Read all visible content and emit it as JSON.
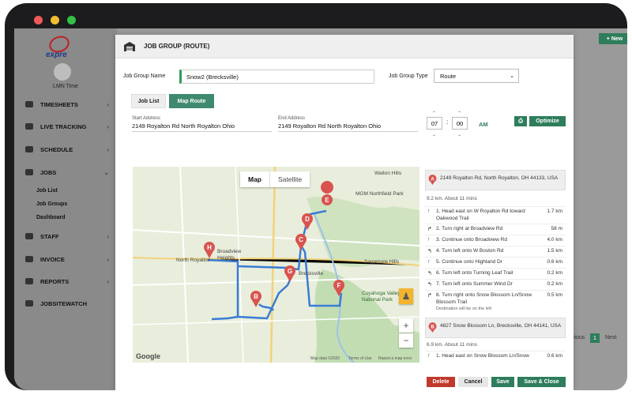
{
  "window": {
    "controls": [
      "close",
      "minimize",
      "maximize"
    ]
  },
  "app": {
    "logo_text": "expre",
    "user_label": "LMN Time",
    "new_button": "+ New",
    "nav": [
      {
        "label": "TIMESHEETS",
        "icon": "clock-icon"
      },
      {
        "label": "LIVE TRACKING",
        "icon": "pin-icon"
      },
      {
        "label": "SCHEDULE",
        "icon": "calendar-icon"
      },
      {
        "label": "JOBS",
        "icon": "briefcase-icon"
      },
      {
        "label": "STAFF",
        "icon": "users-icon"
      },
      {
        "label": "INVOICE",
        "icon": "invoice-icon"
      },
      {
        "label": "REPORTS",
        "icon": "chart-icon"
      },
      {
        "label": "JOBSITEWATCH",
        "icon": "eye-icon"
      }
    ],
    "jobs_sub": [
      "Job List",
      "Job Groups",
      "Dashboard"
    ],
    "pager": {
      "previous": "Previous",
      "current": "1",
      "next": "Next"
    }
  },
  "modal": {
    "title": "JOB GROUP (ROUTE)",
    "group_name_label": "Job Group Name",
    "group_name_value": "Snow2 (Brecksville)",
    "group_type_label": "Job Group Type",
    "group_type_value": "Route",
    "tabs": [
      "Job List",
      "Map Route"
    ],
    "start_label": "Start Address",
    "start_value": "2149 Royalton Rd North Royalton Ohio",
    "end_label": "End Address",
    "end_value": "2149 Royalton Rd North Royalton Ohio",
    "time": {
      "hour": "07",
      "minute": "00",
      "ampm": "AM"
    },
    "optimize": "Optimize",
    "map": {
      "toggle": [
        "Map",
        "Satellite"
      ],
      "places": [
        "Walton Hills",
        "MGM Northfield Park",
        "North Royalton",
        "Broadview Heights",
        "Sagamore Hills",
        "Cuyahoga Valley National Park",
        "Brecksville"
      ],
      "markers": [
        "A",
        "B",
        "C",
        "D",
        "E",
        "F",
        "G",
        "H"
      ],
      "google": "Google",
      "footer": [
        "Map data ©2020",
        "Terms of Use",
        "Report a map error"
      ]
    },
    "directions": {
      "a_address": "2149 Royalton Rd, North Royalton, OH 44133, USA",
      "a_summary": "9.2 km. About 11 mins",
      "steps": [
        {
          "n": "1.",
          "text": "Head east on W Royalton Rd toward Oakwood Trail",
          "km": "1.7 km",
          "arrow": "↑"
        },
        {
          "n": "2.",
          "text": "Turn right at Broadview Rd",
          "km": "58 m",
          "arrow": "↱"
        },
        {
          "n": "3.",
          "text": "Continue onto Broadview Rd",
          "km": "4.0 km",
          "arrow": "↑"
        },
        {
          "n": "4.",
          "text": "Turn left onto W Boston Rd",
          "km": "1.5 km",
          "arrow": "↰"
        },
        {
          "n": "5.",
          "text": "Continue onto Highland Dr",
          "km": "0.6 km",
          "arrow": "↑"
        },
        {
          "n": "6.",
          "text": "Turn left onto Turning Leaf Trail",
          "km": "0.2 km",
          "arrow": "↰"
        },
        {
          "n": "7.",
          "text": "Turn left onto Summer Wind Dr",
          "km": "0.2 km",
          "arrow": "↰"
        },
        {
          "n": "8.",
          "text": "Turn right onto Snow Blossom Ln/Snow Blossom Trail",
          "km": "0.5 km",
          "arrow": "↱",
          "note": "Destination will be on the left"
        }
      ],
      "b_address": "4827 Snow Blossom Ln, Brecksville, OH 44141, USA",
      "b_summary": "6.9 km. About 11 mins",
      "b_step1": {
        "n": "1.",
        "text": "Head east on Snow Blossom Ln/Snow",
        "km": "0.6 km",
        "arrow": "↑"
      }
    },
    "buttons": {
      "delete": "Delete",
      "cancel": "Cancel",
      "save": "Save",
      "save_close": "Save & Close"
    }
  },
  "colors": {
    "accent": "#2e7d5b",
    "danger": "#c0392b",
    "route": "#3a7bd5",
    "marker": "#d9534f"
  }
}
